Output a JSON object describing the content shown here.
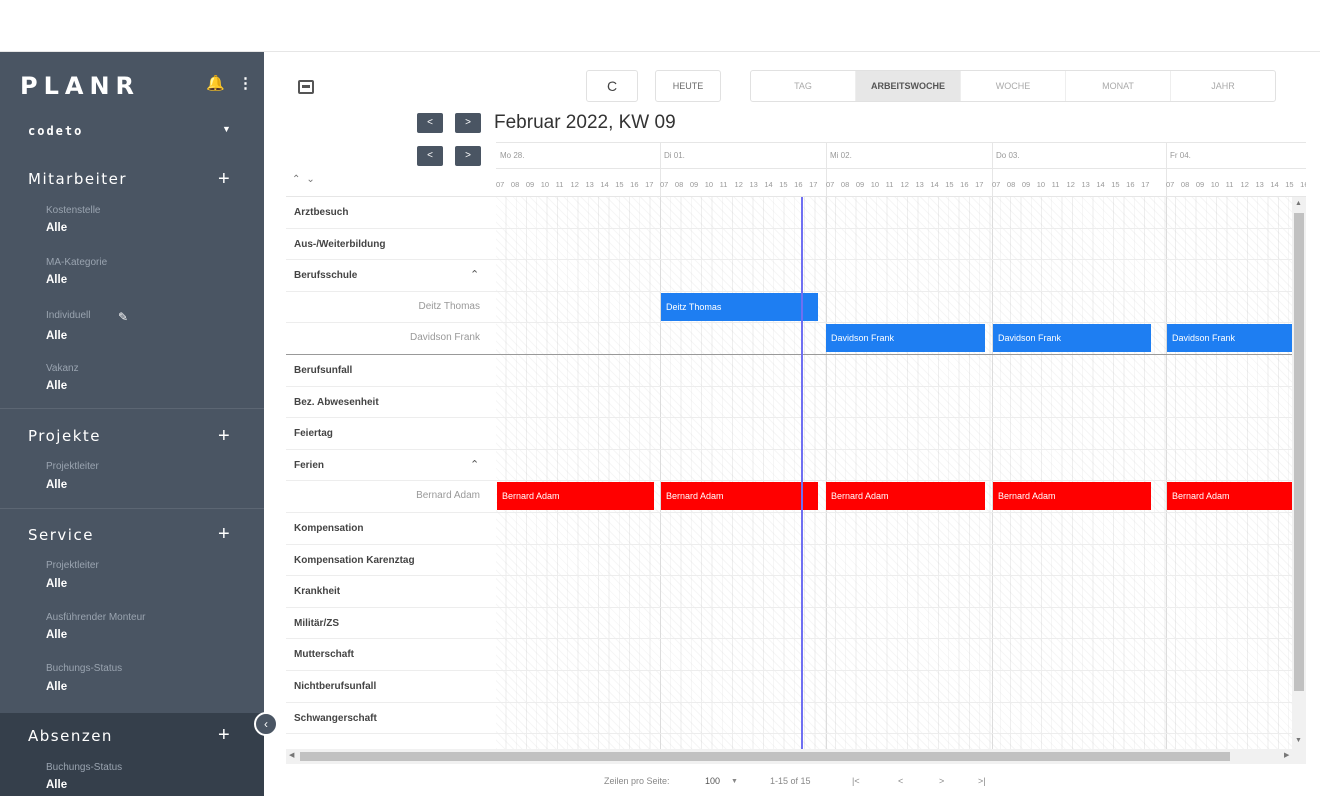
{
  "app": {
    "name": "PLANR",
    "tenant": "codeto"
  },
  "sidebar": {
    "sections": [
      {
        "title": "Mitarbeiter",
        "filters": [
          {
            "label": "Kostenstelle",
            "value": "Alle"
          },
          {
            "label": "MA-Kategorie",
            "value": "Alle"
          },
          {
            "label": "Individuell",
            "value": "Alle"
          },
          {
            "label": "Vakanz",
            "value": "Alle"
          }
        ]
      },
      {
        "title": "Projekte",
        "filters": [
          {
            "label": "Projektleiter",
            "value": "Alle"
          }
        ]
      },
      {
        "title": "Service",
        "filters": [
          {
            "label": "Projektleiter",
            "value": "Alle"
          },
          {
            "label": "Ausführender Monteur",
            "value": "Alle"
          },
          {
            "label": "Buchungs-Status",
            "value": "Alle"
          }
        ]
      },
      {
        "title": "Absenzen",
        "filters": [
          {
            "label": "Buchungs-Status",
            "value": "Alle"
          }
        ]
      }
    ]
  },
  "toolbar": {
    "refresh_glyph": "C",
    "today": "HEUTE",
    "views": [
      "TAG",
      "ARBEITSWOCHE",
      "WOCHE",
      "MONAT",
      "JAHR"
    ],
    "active_view": "ARBEITSWOCHE",
    "period": "Februar 2022, KW 09",
    "prev": "<",
    "next": ">"
  },
  "days": [
    "Mo 28.",
    "Di 01.",
    "Mi 02.",
    "Do 03.",
    "Fr 04."
  ],
  "hours": [
    "07",
    "08",
    "09",
    "10",
    "11",
    "12",
    "13",
    "14",
    "15",
    "16",
    "17"
  ],
  "rows": [
    {
      "label": "Arztbesuch",
      "type": "group"
    },
    {
      "label": "Aus-/Weiterbildung",
      "type": "group"
    },
    {
      "label": "Berufsschule",
      "type": "group",
      "expanded": true
    },
    {
      "label": "Deitz Thomas",
      "type": "sub"
    },
    {
      "label": "Davidson Frank",
      "type": "sub"
    },
    {
      "label": "Berufsunfall",
      "type": "group"
    },
    {
      "label": "Bez. Abwesenheit",
      "type": "group"
    },
    {
      "label": "Feiertag",
      "type": "group"
    },
    {
      "label": "Ferien",
      "type": "group",
      "expanded": true
    },
    {
      "label": "Bernard Adam",
      "type": "sub"
    },
    {
      "label": "Kompensation",
      "type": "group"
    },
    {
      "label": "Kompensation Karenztag",
      "type": "group"
    },
    {
      "label": "Krankheit",
      "type": "group"
    },
    {
      "label": "Militär/ZS",
      "type": "group"
    },
    {
      "label": "Mutterschaft",
      "type": "group"
    },
    {
      "label": "Nichtberufsunfall",
      "type": "group"
    },
    {
      "label": "Schwangerschaft",
      "type": "group"
    }
  ],
  "bookings": [
    {
      "row": 3,
      "name": "Deitz Thomas",
      "color": "#1e7ef2",
      "day": 1
    },
    {
      "row": 4,
      "name": "Davidson Frank",
      "color": "#1e7ef2",
      "day": 2
    },
    {
      "row": 4,
      "name": "Davidson Frank",
      "color": "#1e7ef2",
      "day": 3
    },
    {
      "row": 4,
      "name": "Davidson Frank",
      "color": "#1e7ef2",
      "day": 4
    },
    {
      "row": 9,
      "name": "Bernard Adam",
      "color": "#ff0000",
      "day": 0
    },
    {
      "row": 9,
      "name": "Bernard Adam",
      "color": "#ff0000",
      "day": 1
    },
    {
      "row": 9,
      "name": "Bernard Adam",
      "color": "#ff0000",
      "day": 2
    },
    {
      "row": 9,
      "name": "Bernard Adam",
      "color": "#ff0000",
      "day": 3
    },
    {
      "row": 9,
      "name": "Bernard Adam",
      "color": "#ff0000",
      "day": 4
    }
  ],
  "footer": {
    "rows_per_page_label": "Zeilen pro Seite:",
    "rows_per_page": "100",
    "range": "1-15 of 15",
    "first": "|<",
    "prev": "<",
    "next": ">",
    "last": ">|"
  },
  "colors": {
    "sidebar": "#4a5563",
    "sidebar_active": "#353f4b",
    "booking_blue": "#1e7ef2",
    "booking_red": "#ff0000",
    "now_line": "#6f6ff2"
  }
}
